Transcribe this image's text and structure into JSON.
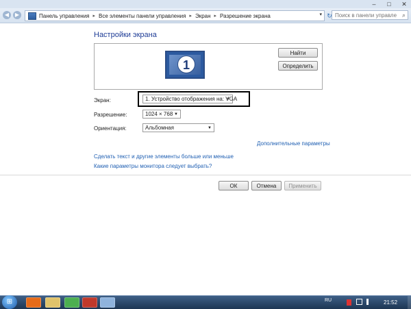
{
  "window": {
    "minimize_glyph": "–",
    "maximize_glyph": "□",
    "close_glyph": "✕"
  },
  "nav": {
    "back_glyph": "◀",
    "forward_glyph": "▶",
    "breadcrumbs": [
      "Панель управления",
      "Все элементы панели управления",
      "Экран",
      "Разрешение экрана"
    ],
    "separator": "▸",
    "address_dropdown_glyph": "▾",
    "refresh_glyph": "↻",
    "search_placeholder": "Поиск в панели управления",
    "search_icon": "magnifier-icon",
    "search_glyph": "⌕"
  },
  "page": {
    "title": "Настройки экрана"
  },
  "preview": {
    "monitor_number": "1",
    "find_label": "Найти",
    "detect_label": "Определить"
  },
  "settings": {
    "display_label": "Экран:",
    "display_value": "1. Устройство отображения на: VGA",
    "resolution_label": "Разрешение:",
    "resolution_value": "1024 × 768",
    "orientation_label": "Ориентация:",
    "orientation_value": "Альбомная",
    "dropdown_glyph": "▼",
    "advanced_link": "Дополнительные параметры"
  },
  "links": {
    "text_size": "Сделать текст и другие элементы больше или меньше",
    "monitor_help": "Какие параметры монитора следует выбрать?"
  },
  "dialog": {
    "ok": "ОК",
    "cancel": "Отмена",
    "apply": "Применить"
  },
  "taskbar": {
    "start_glyph": "⊞",
    "apps": [
      "firefox-icon",
      "explorer-icon",
      "chrome-icon",
      "media-icon",
      "control-panel-icon"
    ],
    "language": "RU",
    "clock": "21:52"
  },
  "colors": {
    "title": "#1e3c96",
    "link": "#1f5fb2",
    "highlight_border": "#000000"
  }
}
